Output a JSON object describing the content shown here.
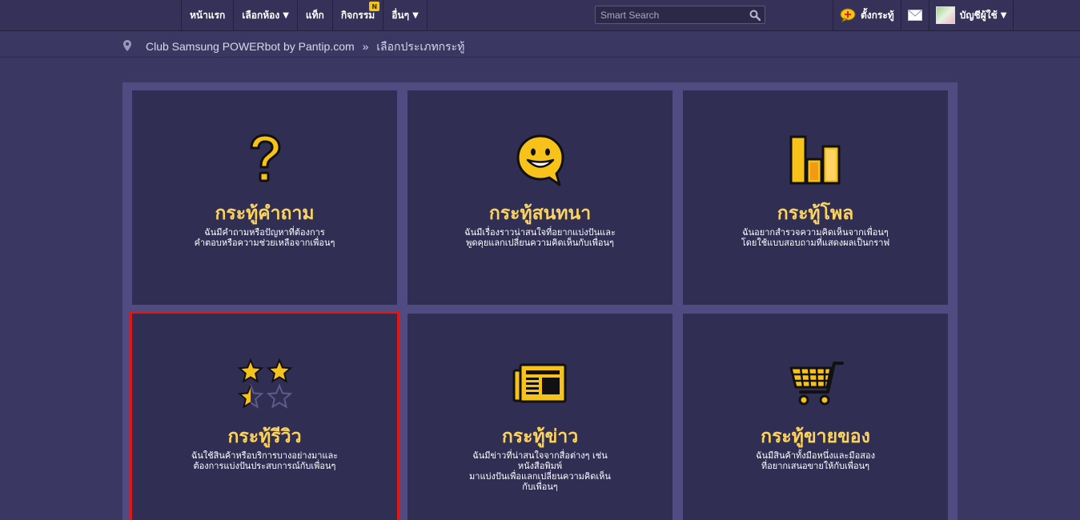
{
  "nav": {
    "items": [
      {
        "label": "หน้าแรก"
      },
      {
        "label": "เลือกห้อง",
        "caret": "▼"
      },
      {
        "label": "แท็ก"
      },
      {
        "label": "กิจกรรม",
        "badge": "N"
      },
      {
        "label": "อื่นๆ",
        "caret": "▼"
      }
    ],
    "search": {
      "placeholder": "Smart Search"
    },
    "right": {
      "create_label": "ตั้งกระทู้",
      "account_label": "บัญชีผู้ใช้",
      "account_caret": "▼"
    }
  },
  "breadcrumb": {
    "club": "Club Samsung POWERbot by Pantip.com",
    "separator": "»",
    "current": "เลือกประเภทกระทู้"
  },
  "cards": [
    {
      "icon": "question-mark-icon",
      "title": "กระทู้คำถาม",
      "desc": [
        "ฉันมีคำถามหรือปัญหาที่ต้องการ",
        "คำตอบหรือความช่วยเหลือจากเพื่อนๆ"
      ]
    },
    {
      "icon": "smiley-chat-icon",
      "title": "กระทู้สนทนา",
      "desc": [
        "ฉันมีเรื่องราวน่าสนใจที่อยากแบ่งปันและ",
        "พูดคุยแลกเปลี่ยนความคิดเห็นกับเพื่อนๆ"
      ]
    },
    {
      "icon": "bar-chart-icon",
      "title": "กระทู้โพล",
      "desc": [
        "ฉันอยากสำรวจความคิดเห็นจากเพื่อนๆ",
        "โดยใช้แบบสอบถามที่แสดงผลเป็นกราฟ"
      ]
    },
    {
      "icon": "star-rating-icon",
      "title": "กระทู้รีวิว",
      "desc": [
        "ฉันใช้สินค้าหรือบริการบางอย่างมาและ",
        "ต้องการแบ่งปันประสบการณ์กับเพื่อนๆ"
      ]
    },
    {
      "icon": "newspaper-icon",
      "title": "กระทู้ข่าว",
      "desc": [
        "ฉันมีข่าวที่น่าสนใจจากสื่อต่างๆ เช่น",
        "หนังสือพิมพ์",
        "มาแบ่งปันเพื่อแลกเปลี่ยนความคิดเห็น",
        "กับเพื่อนๆ"
      ]
    },
    {
      "icon": "shopping-cart-icon",
      "title": "กระทู้ขายของ",
      "desc": [
        "ฉันมีสินค้าทั้งมือหนึ่งและมือสอง",
        "ที่อยากเสนอขายให้กับเพื่อนๆ"
      ]
    }
  ],
  "colors": {
    "background": "#3b3763",
    "card": "#312e54",
    "panel": "#504c82",
    "title": "#fbd45f",
    "icon": "#f7c31a",
    "selection": "#e01717"
  }
}
